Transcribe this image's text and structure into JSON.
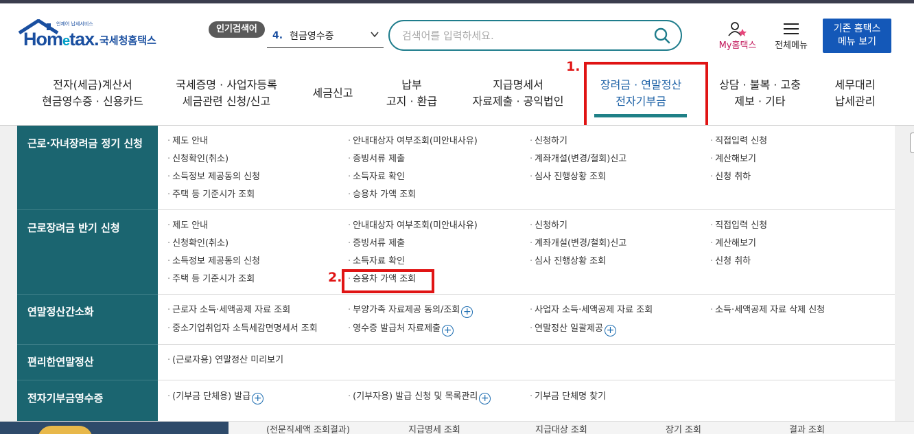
{
  "header": {
    "logo": {
      "tagline": "언제어 납세서비스",
      "wordmark_a": "Hom",
      "wordmark_e": "e",
      "wordmark_b": "tax.",
      "korean": "국세청홈택스"
    },
    "popular": {
      "badge": "인기검색어",
      "rank": "4.",
      "term": "현금영수증"
    },
    "search": {
      "placeholder": "검색어를 입력하세요."
    },
    "my_hometax": "My홈택스",
    "all_menu": "전체메뉴",
    "legacy": {
      "line1": "기존 홈택스",
      "line2": "메뉴 보기"
    }
  },
  "nav": [
    {
      "line1": "전자(세금)계산서",
      "line2": "현금영수증 · 신용카드"
    },
    {
      "line1": "국세증명 · 사업자등록",
      "line2": "세금관련 신청/신고"
    },
    {
      "line1": "세금신고",
      "line2": ""
    },
    {
      "line1": "납부",
      "line2": "고지 · 환급"
    },
    {
      "line1": "지급명세서",
      "line2": "자료제출 · 공익법인"
    },
    {
      "line1": "장려금 · 연말정산",
      "line2": "전자기부금",
      "active": true
    },
    {
      "line1": "상담 · 불복 · 고충",
      "line2": "제보 · 기타"
    },
    {
      "line1": "세무대리",
      "line2": "납세관리"
    }
  ],
  "annotations": {
    "step1": "1.",
    "step2": "2.",
    "color": "#e01414"
  },
  "menu": {
    "sections": [
      {
        "title": "근로·자녀장려금 정기 신청",
        "links": [
          [
            "제도 안내",
            "안내대상자 여부조회(미안내사유)",
            "신청하기",
            "직접입력 신청"
          ],
          [
            "신청확인(취소)",
            "증빙서류 제출",
            "계좌개설(변경/철회)신고",
            "계산해보기"
          ],
          [
            "소득정보 제공동의 신청",
            "소득자료 확인",
            "심사 진행상황 조회",
            "신청 취하"
          ],
          [
            "주택 등 기준시가 조회",
            "승용차 가액 조회",
            "",
            ""
          ]
        ]
      },
      {
        "title": "근로장려금 반기 신청",
        "links": [
          [
            "제도 안내",
            "안내대상자 여부조회(미안내사유)",
            "신청하기",
            "직접입력 신청"
          ],
          [
            "신청확인(취소)",
            "증빙서류 제출",
            "계좌개설(변경/철회)신고",
            "계산해보기"
          ],
          [
            "소득정보 제공동의 신청",
            "소득자료 확인",
            "심사 진행상황 조회",
            "신청 취하"
          ],
          [
            "주택 등 기준시가 조회",
            "승용차 가액 조회",
            "",
            ""
          ]
        ]
      },
      {
        "title": "연말정산간소화",
        "links": [
          [
            "근로자 소득·세액공제 자료 조회",
            "부양가족 자료제공 동의/조회",
            "사업자 소득·세액공제 자료 조회",
            "소득·세액공제 자료 삭제 신청"
          ],
          [
            "중소기업취업자 소득세감면명세서 조회",
            "영수증 발급처 자료제출",
            "연말정산 일괄제공",
            ""
          ]
        ]
      },
      {
        "title": "편리한연말정산",
        "links": [
          [
            "(근로자용) 연말정산 미리보기",
            "",
            "",
            ""
          ]
        ]
      },
      {
        "title": "전자기부금영수증",
        "links": [
          [
            "(기부금 단체용) 발급",
            "(기부자용) 발급 신청 및 목록관리",
            "기부금 단체명 찾기",
            ""
          ]
        ]
      }
    ]
  },
  "bottom_tabs": [
    "(전문직세액 조회결과)",
    "지급명세 조회",
    "지급대상 조회",
    "장기 조회",
    "결과 조회"
  ],
  "colors": {
    "category_bg": "#1b6570",
    "brand_blue": "#1458b8",
    "accent_teal": "#1f8087"
  }
}
